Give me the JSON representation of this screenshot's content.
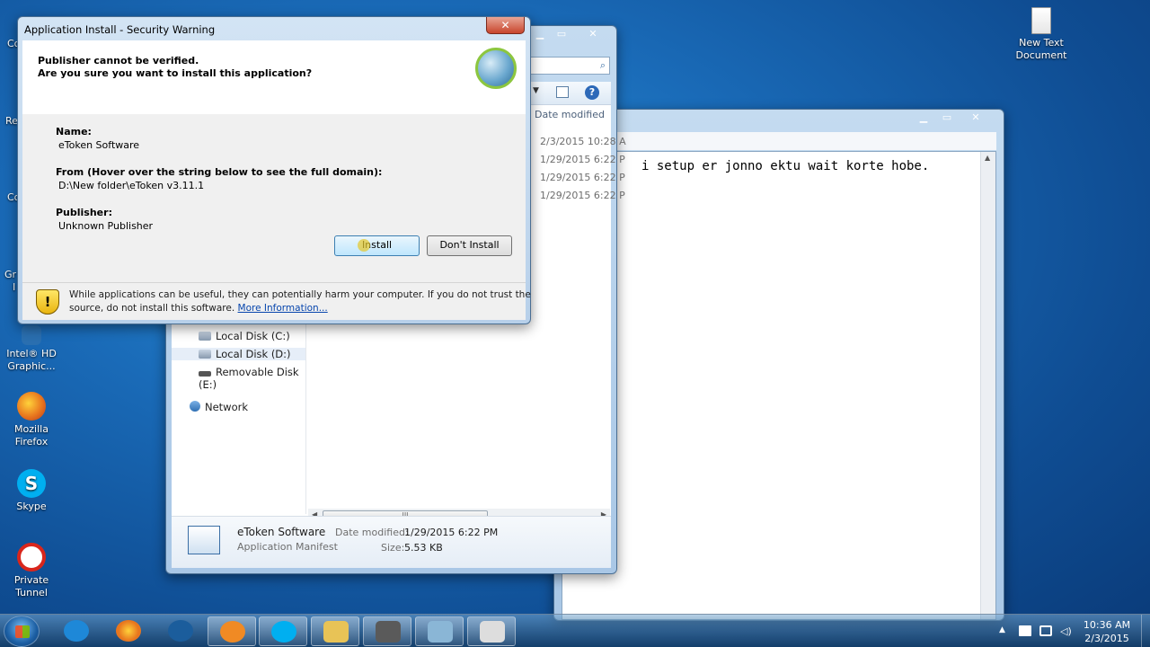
{
  "desktop": {
    "icons_right": [
      {
        "label_line1": "New Text",
        "label_line2": "Document"
      }
    ],
    "icons_left": [
      {
        "label_line1": "Intel® HD",
        "label_line2": "Graphic...",
        "color": "#2a6fb0"
      },
      {
        "label_line1": "Mozilla",
        "label_line2": "Firefox",
        "color": "#e8761e"
      },
      {
        "label_line1": "Skype",
        "label_line2": "",
        "color": "#00aff0"
      },
      {
        "label_line1": "Private",
        "label_line2": "Tunnel",
        "color": "#d9261c"
      }
    ],
    "partial_labels": [
      "Co",
      "Re",
      "Co",
      "Gr",
      "I"
    ]
  },
  "notepad": {
    "text": "i setup er jonno ektu wait korte hobe.",
    "controls": {
      "minimize": "▁",
      "maximize": "▭",
      "close": "✕"
    }
  },
  "explorer": {
    "column_header": "Date modified",
    "file_dates": [
      "2/3/2015 10:28 A",
      "1/29/2015 6:22 P",
      "1/29/2015 6:22 P",
      "1/29/2015 6:22 P"
    ],
    "nav_items": [
      {
        "label": "Local Disk (C:)",
        "icon": "drive-icon"
      },
      {
        "label": "Local Disk (D:)",
        "icon": "drive-icon"
      },
      {
        "label": "Removable Disk (E:)",
        "icon": "usb-drive-icon"
      },
      {
        "label": "Network",
        "icon": "network-icon"
      }
    ],
    "details": {
      "name": "eToken Software",
      "type": "Application Manifest",
      "date_label": "Date modified:",
      "date_value": "1/29/2015 6:22 PM",
      "size_label": "Size:",
      "size_value": "5.53 KB"
    },
    "scroll_grip": "III"
  },
  "dialog": {
    "title": "Application Install - Security Warning",
    "close": "✕",
    "header_line1": "Publisher cannot be verified.",
    "header_line2": "Are you sure you want to install this application?",
    "name_label": "Name:",
    "name_value": "eToken Software",
    "from_label": "From (Hover over the string below to see the full domain):",
    "from_value": "D:\\New folder\\eToken v3.11.1",
    "publisher_label": "Publisher:",
    "publisher_value": "Unknown Publisher",
    "install_button": "Install",
    "dont_install_button": "Don't Install",
    "warning_text_line1": "While applications can be useful, they can potentially harm your computer. If you do not trust the",
    "warning_text_line2": "source, do not install this software.",
    "more_info_link": "More Information..."
  },
  "taskbar": {
    "items": [
      {
        "name": "ie",
        "color": "#1e88d8"
      },
      {
        "name": "firefox",
        "color": "#e8761e"
      },
      {
        "name": "app3",
        "color": "#1b5d9c"
      },
      {
        "name": "app4",
        "color": "#f08a24"
      },
      {
        "name": "skype",
        "color": "#00aff0"
      },
      {
        "name": "explorer",
        "color": "#e8c356"
      },
      {
        "name": "media",
        "color": "#5a5a5a"
      },
      {
        "name": "notepad-like",
        "color": "#8ab6d6"
      },
      {
        "name": "manifest",
        "color": "#dddddd"
      }
    ],
    "clock_time": "10:36 AM",
    "clock_date": "2/3/2015",
    "colors": {
      "accent": "#1a6bb8"
    }
  }
}
